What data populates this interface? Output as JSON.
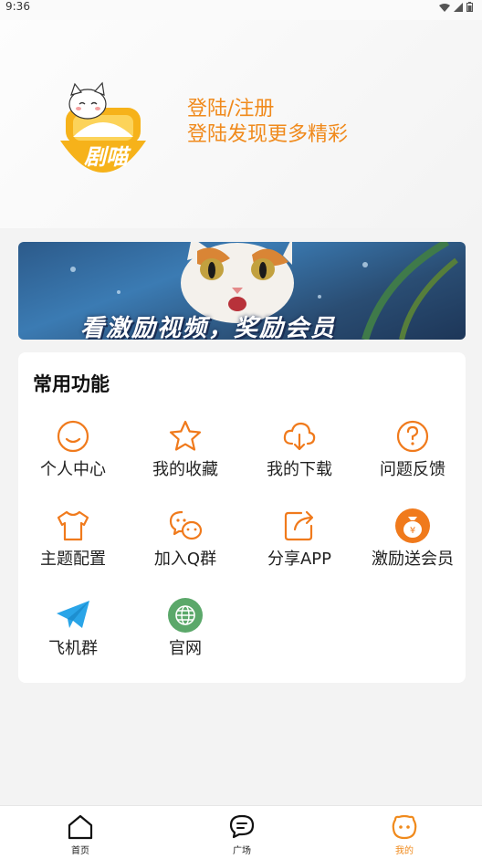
{
  "status_bar": {
    "time": "9:36"
  },
  "header": {
    "logo_text": "剧喵",
    "login_title": "登陆/注册",
    "login_subtitle": "登陆发现更多精彩"
  },
  "banner": {
    "text": "看激励视频，奖励会员"
  },
  "features": {
    "title": "常用功能",
    "items": [
      {
        "label": "个人中心",
        "icon": "smile-icon"
      },
      {
        "label": "我的收藏",
        "icon": "star-icon"
      },
      {
        "label": "我的下载",
        "icon": "cloud-download-icon"
      },
      {
        "label": "问题反馈",
        "icon": "question-icon"
      },
      {
        "label": "主题配置",
        "icon": "tshirt-icon"
      },
      {
        "label": "加入Q群",
        "icon": "chat-icon"
      },
      {
        "label": "分享APP",
        "icon": "share-icon"
      },
      {
        "label": "激励送会员",
        "icon": "money-bag-icon"
      },
      {
        "label": "飞机群",
        "icon": "paper-plane-icon"
      },
      {
        "label": "官网",
        "icon": "globe-icon"
      }
    ]
  },
  "bottom_nav": {
    "items": [
      {
        "label": "首页",
        "icon": "home-icon"
      },
      {
        "label": "广场",
        "icon": "chat-bubble-icon"
      },
      {
        "label": "我的",
        "icon": "face-icon",
        "active": true
      }
    ]
  },
  "colors": {
    "accent": "#f08a1c",
    "background": "#f3f3f3",
    "card": "#ffffff"
  }
}
